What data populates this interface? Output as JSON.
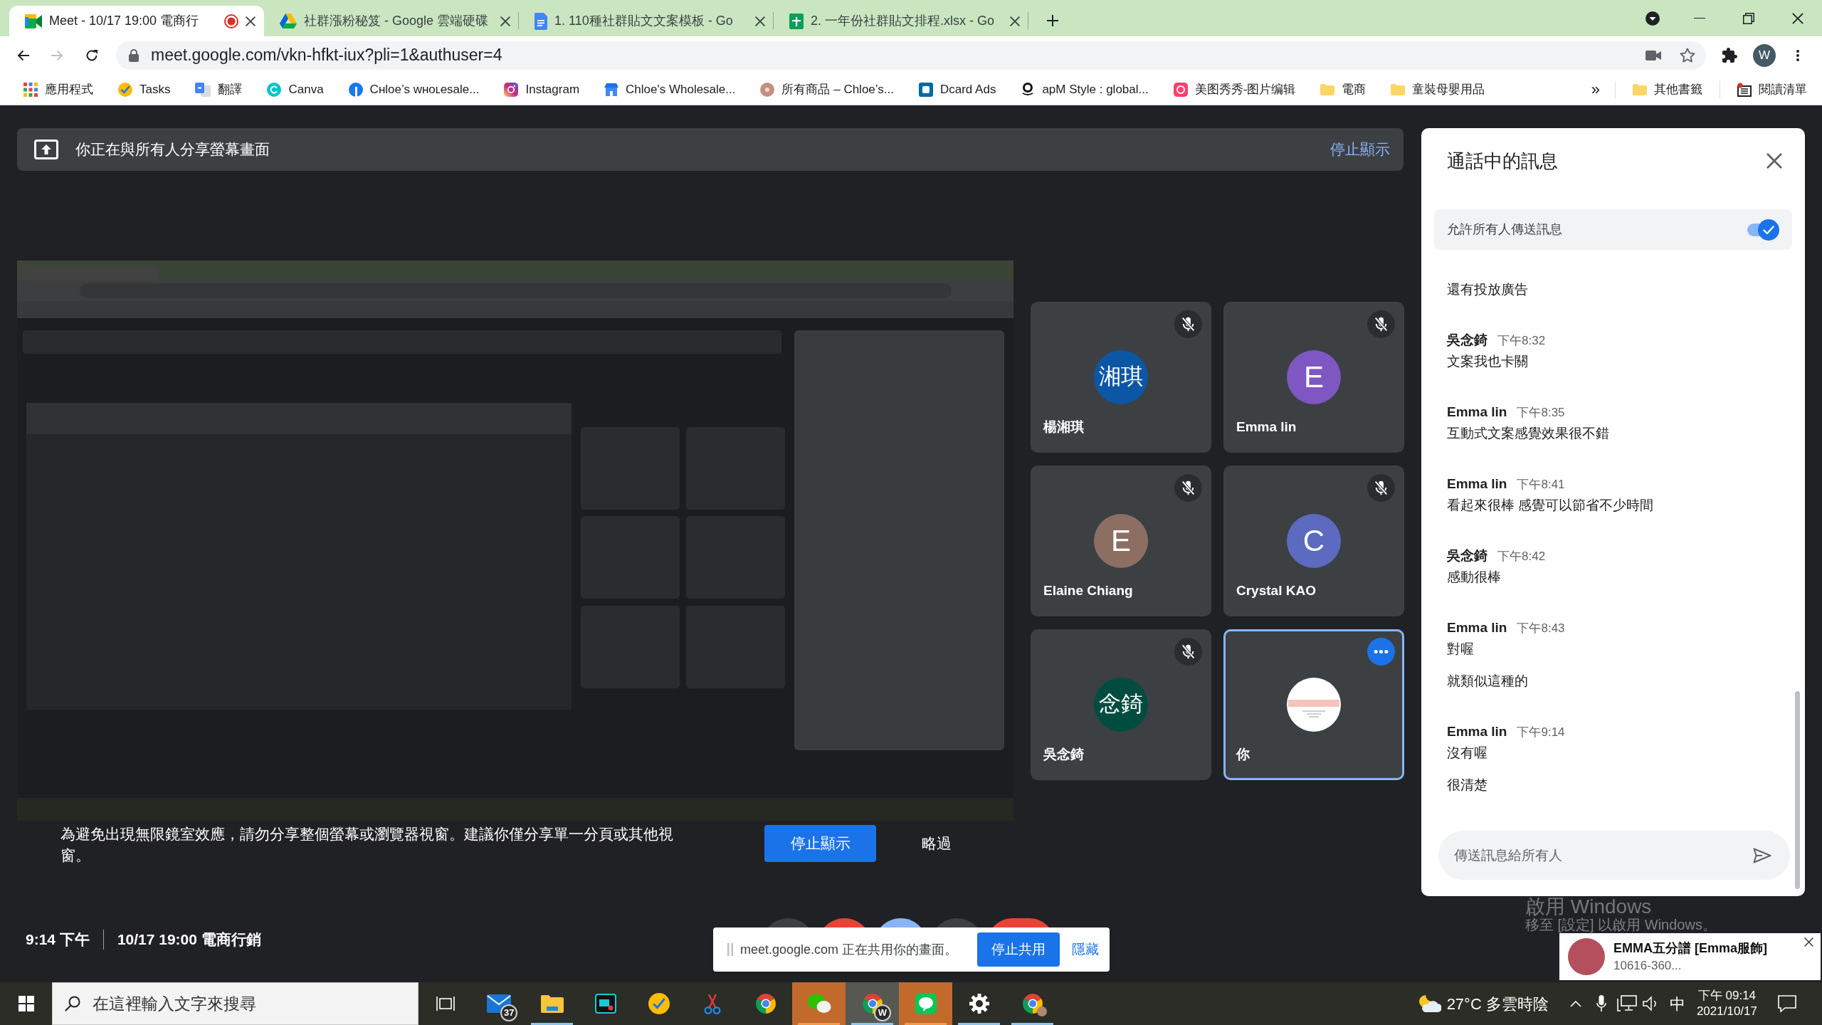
{
  "browser": {
    "tabs": [
      {
        "title": "Meet - 10/17 19:00 電商行",
        "selected": true,
        "recording": true
      },
      {
        "title": "社群漲粉秘笈 - Google 雲端硬碟",
        "selected": false,
        "recording": false
      },
      {
        "title": "1. 110種社群貼文文案模板 - Go",
        "selected": false,
        "recording": false
      },
      {
        "title": "2. 一年份社群貼文排程.xlsx - Go",
        "selected": false,
        "recording": false
      }
    ],
    "navigation": {
      "back_disabled": false,
      "forward_disabled": true
    },
    "address": "meet.google.com/vkn-hfkt-iux?pli=1&authuser=4",
    "profile_initial": "W",
    "bookmarks": [
      {
        "label": "應用程式"
      },
      {
        "label": "Tasks"
      },
      {
        "label": "翻譯"
      },
      {
        "label": "Canva"
      },
      {
        "label": "Cʜloe’s wʜoʟesale..."
      },
      {
        "label": "Instagram"
      },
      {
        "label": "Chloe's Wholesale..."
      },
      {
        "label": "所有商品 – Chloe’s..."
      },
      {
        "label": "Dcard Ads"
      },
      {
        "label": "apM Style : global..."
      },
      {
        "label": "美图秀秀-图片编辑"
      },
      {
        "label": "電商"
      },
      {
        "label": "童裝母嬰用品"
      }
    ],
    "bookmarks_overflow": "»",
    "other_bookmarks": [
      {
        "label": "其他書籤"
      },
      {
        "label": "閱讀清單"
      }
    ]
  },
  "meet": {
    "presenting_banner": {
      "text": "你正在與所有人分享螢幕畫面",
      "action": "停止顯示"
    },
    "participants": [
      {
        "name": "楊湘琪",
        "avatar": {
          "kind": "initials",
          "text": "湘琪",
          "color": "#0b57a6"
        },
        "muted": true,
        "focused": false
      },
      {
        "name": "Emma lin",
        "avatar": {
          "kind": "initials",
          "text": "E",
          "color": "#7e57c2"
        },
        "muted": true,
        "focused": false
      },
      {
        "name": "Elaine Chiang",
        "avatar": {
          "kind": "initials",
          "text": "E",
          "color": "#8d6e63"
        },
        "muted": true,
        "focused": false
      },
      {
        "name": "Crystal KAO",
        "avatar": {
          "kind": "initials",
          "text": "C",
          "color": "#5c6bc0"
        },
        "muted": true,
        "focused": false
      },
      {
        "name": "吳念錡",
        "avatar": {
          "kind": "initials",
          "text": "念錡",
          "color": "#004d40"
        },
        "muted": true,
        "focused": false
      },
      {
        "name": "你",
        "avatar": {
          "kind": "picture"
        },
        "muted": false,
        "focused": true
      }
    ],
    "mirror_warning": {
      "text": "為避免出現無限鏡室效應，請勿分享整個螢幕或瀏覽器視窗。建議你僅分享單一分頁或其他視窗。",
      "stop": "停止顯示",
      "skip": "略過"
    },
    "meeting_info": {
      "time": "9:14 下午",
      "title": "10/17 19:00 電商行銷"
    },
    "controls": [
      {
        "kind": "circle",
        "color": "#3c4043"
      },
      {
        "kind": "circle",
        "color": "#ea4335"
      },
      {
        "kind": "circle",
        "color": "#8ab4f8"
      },
      {
        "kind": "circle",
        "color": "#3c4043"
      },
      {
        "kind": "pill",
        "color": "#ea4335"
      }
    ],
    "chat": {
      "title": "通話中的訊息",
      "allow_all": {
        "label": "允許所有人傳送訊息",
        "on": true
      },
      "messages": [
        {
          "lines": [
            "還有投放廣告"
          ]
        },
        {
          "sender": "吳念錡",
          "time": "下午8:32",
          "lines": [
            "文案我也卡關"
          ]
        },
        {
          "sender": "Emma lin",
          "time": "下午8:35",
          "lines": [
            "互動式文案感覺效果很不錯"
          ]
        },
        {
          "sender": "Emma lin",
          "time": "下午8:41",
          "lines": [
            "看起來很棒 感覺可以節省不少時間"
          ]
        },
        {
          "sender": "吳念錡",
          "time": "下午8:42",
          "lines": [
            "感動很棒"
          ]
        },
        {
          "sender": "Emma lin",
          "time": "下午8:43",
          "lines": [
            "對喔",
            "就類似這種的"
          ]
        },
        {
          "sender": "Emma lin",
          "time": "下午9:14",
          "lines": [
            "沒有喔",
            "很清楚"
          ]
        }
      ],
      "input": {
        "placeholder": "傳送訊息給所有人"
      }
    }
  },
  "share_bar": {
    "text": "meet.google.com 正在共用你的畫面。",
    "stop": "停止共用",
    "hide": "隱藏"
  },
  "windows_notice": {
    "title": "啟用 Windows",
    "hint": "移至 [設定] 以啟用 Windows。"
  },
  "notification": {
    "title": "EMMA五分譜 [Emma服飾]",
    "body": "10616-360..."
  },
  "taskbar": {
    "search": {
      "placeholder": "在這裡輸入文字來搜尋"
    },
    "apps": [
      {
        "running": false,
        "flashing": false,
        "selected": false,
        "badge": "37"
      },
      {
        "running": true,
        "flashing": false,
        "selected": false
      },
      {
        "running": false,
        "flashing": false,
        "selected": false
      },
      {
        "running": false,
        "flashing": false,
        "selected": false
      },
      {
        "running": false,
        "flashing": false,
        "selected": false
      },
      {
        "running": false,
        "flashing": false,
        "selected": false
      },
      {
        "running": true,
        "flashing": true,
        "selected": false
      },
      {
        "running": true,
        "flashing": false,
        "selected": true,
        "badge": "W"
      },
      {
        "running": true,
        "flashing": true,
        "selected": false
      },
      {
        "running": true,
        "flashing": false,
        "selected": false
      },
      {
        "running": true,
        "flashing": false,
        "selected": false
      }
    ],
    "weather": "27°C 多雲時陰",
    "ime": "中",
    "time": "下午 09:14",
    "date": "2021/10/17"
  }
}
